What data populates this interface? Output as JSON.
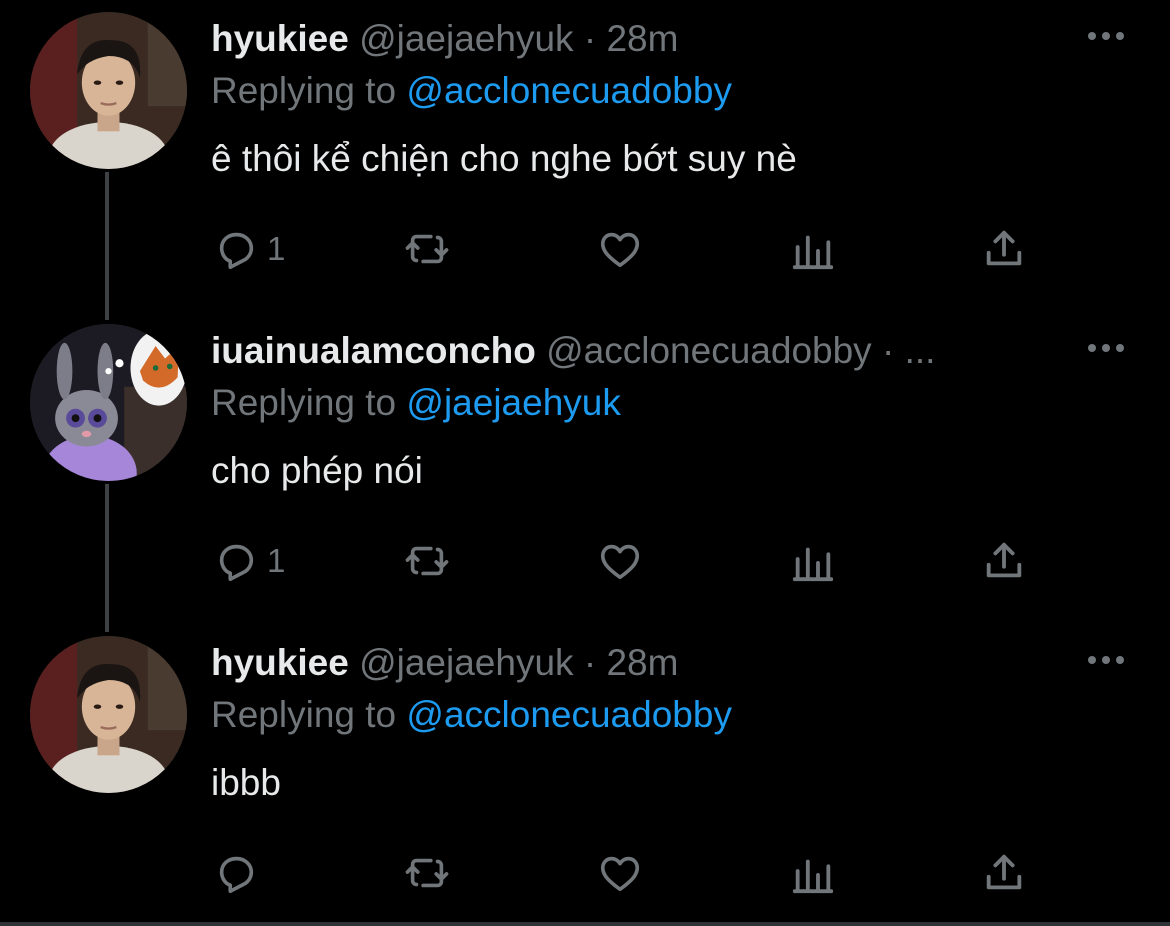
{
  "colors": {
    "background": "#000000",
    "text_primary": "#e7e9ea",
    "text_secondary": "#71767b",
    "accent": "#1d9bf0",
    "thread_line": "#3e4144"
  },
  "tweets": [
    {
      "name": "hyukiee",
      "handle": "@jaejaehyuk",
      "separator": "·",
      "time": "28m",
      "replying_label": "Replying to",
      "replying_to": "@acclonecuadobby",
      "text": "ê thôi kể chiện cho nghe bớt suy nè",
      "reply_count": "1",
      "avatar_icon": "portrait-photo"
    },
    {
      "name": "iuainualamconcho",
      "handle": "@acclonecuadobby",
      "separator": "·",
      "time": "...",
      "replying_label": "Replying to",
      "replying_to": "@jaejaehyuk",
      "text": "cho phép nói",
      "reply_count": "1",
      "avatar_icon": "cartoon-bunny-fox"
    },
    {
      "name": "hyukiee",
      "handle": "@jaejaehyuk",
      "separator": "·",
      "time": "28m",
      "replying_label": "Replying to",
      "replying_to": "@acclonecuadobby",
      "text": "ibbb",
      "reply_count": "",
      "avatar_icon": "portrait-photo"
    }
  ],
  "action_icons": [
    "reply-icon",
    "retweet-icon",
    "like-icon",
    "analytics-icon",
    "share-icon"
  ]
}
